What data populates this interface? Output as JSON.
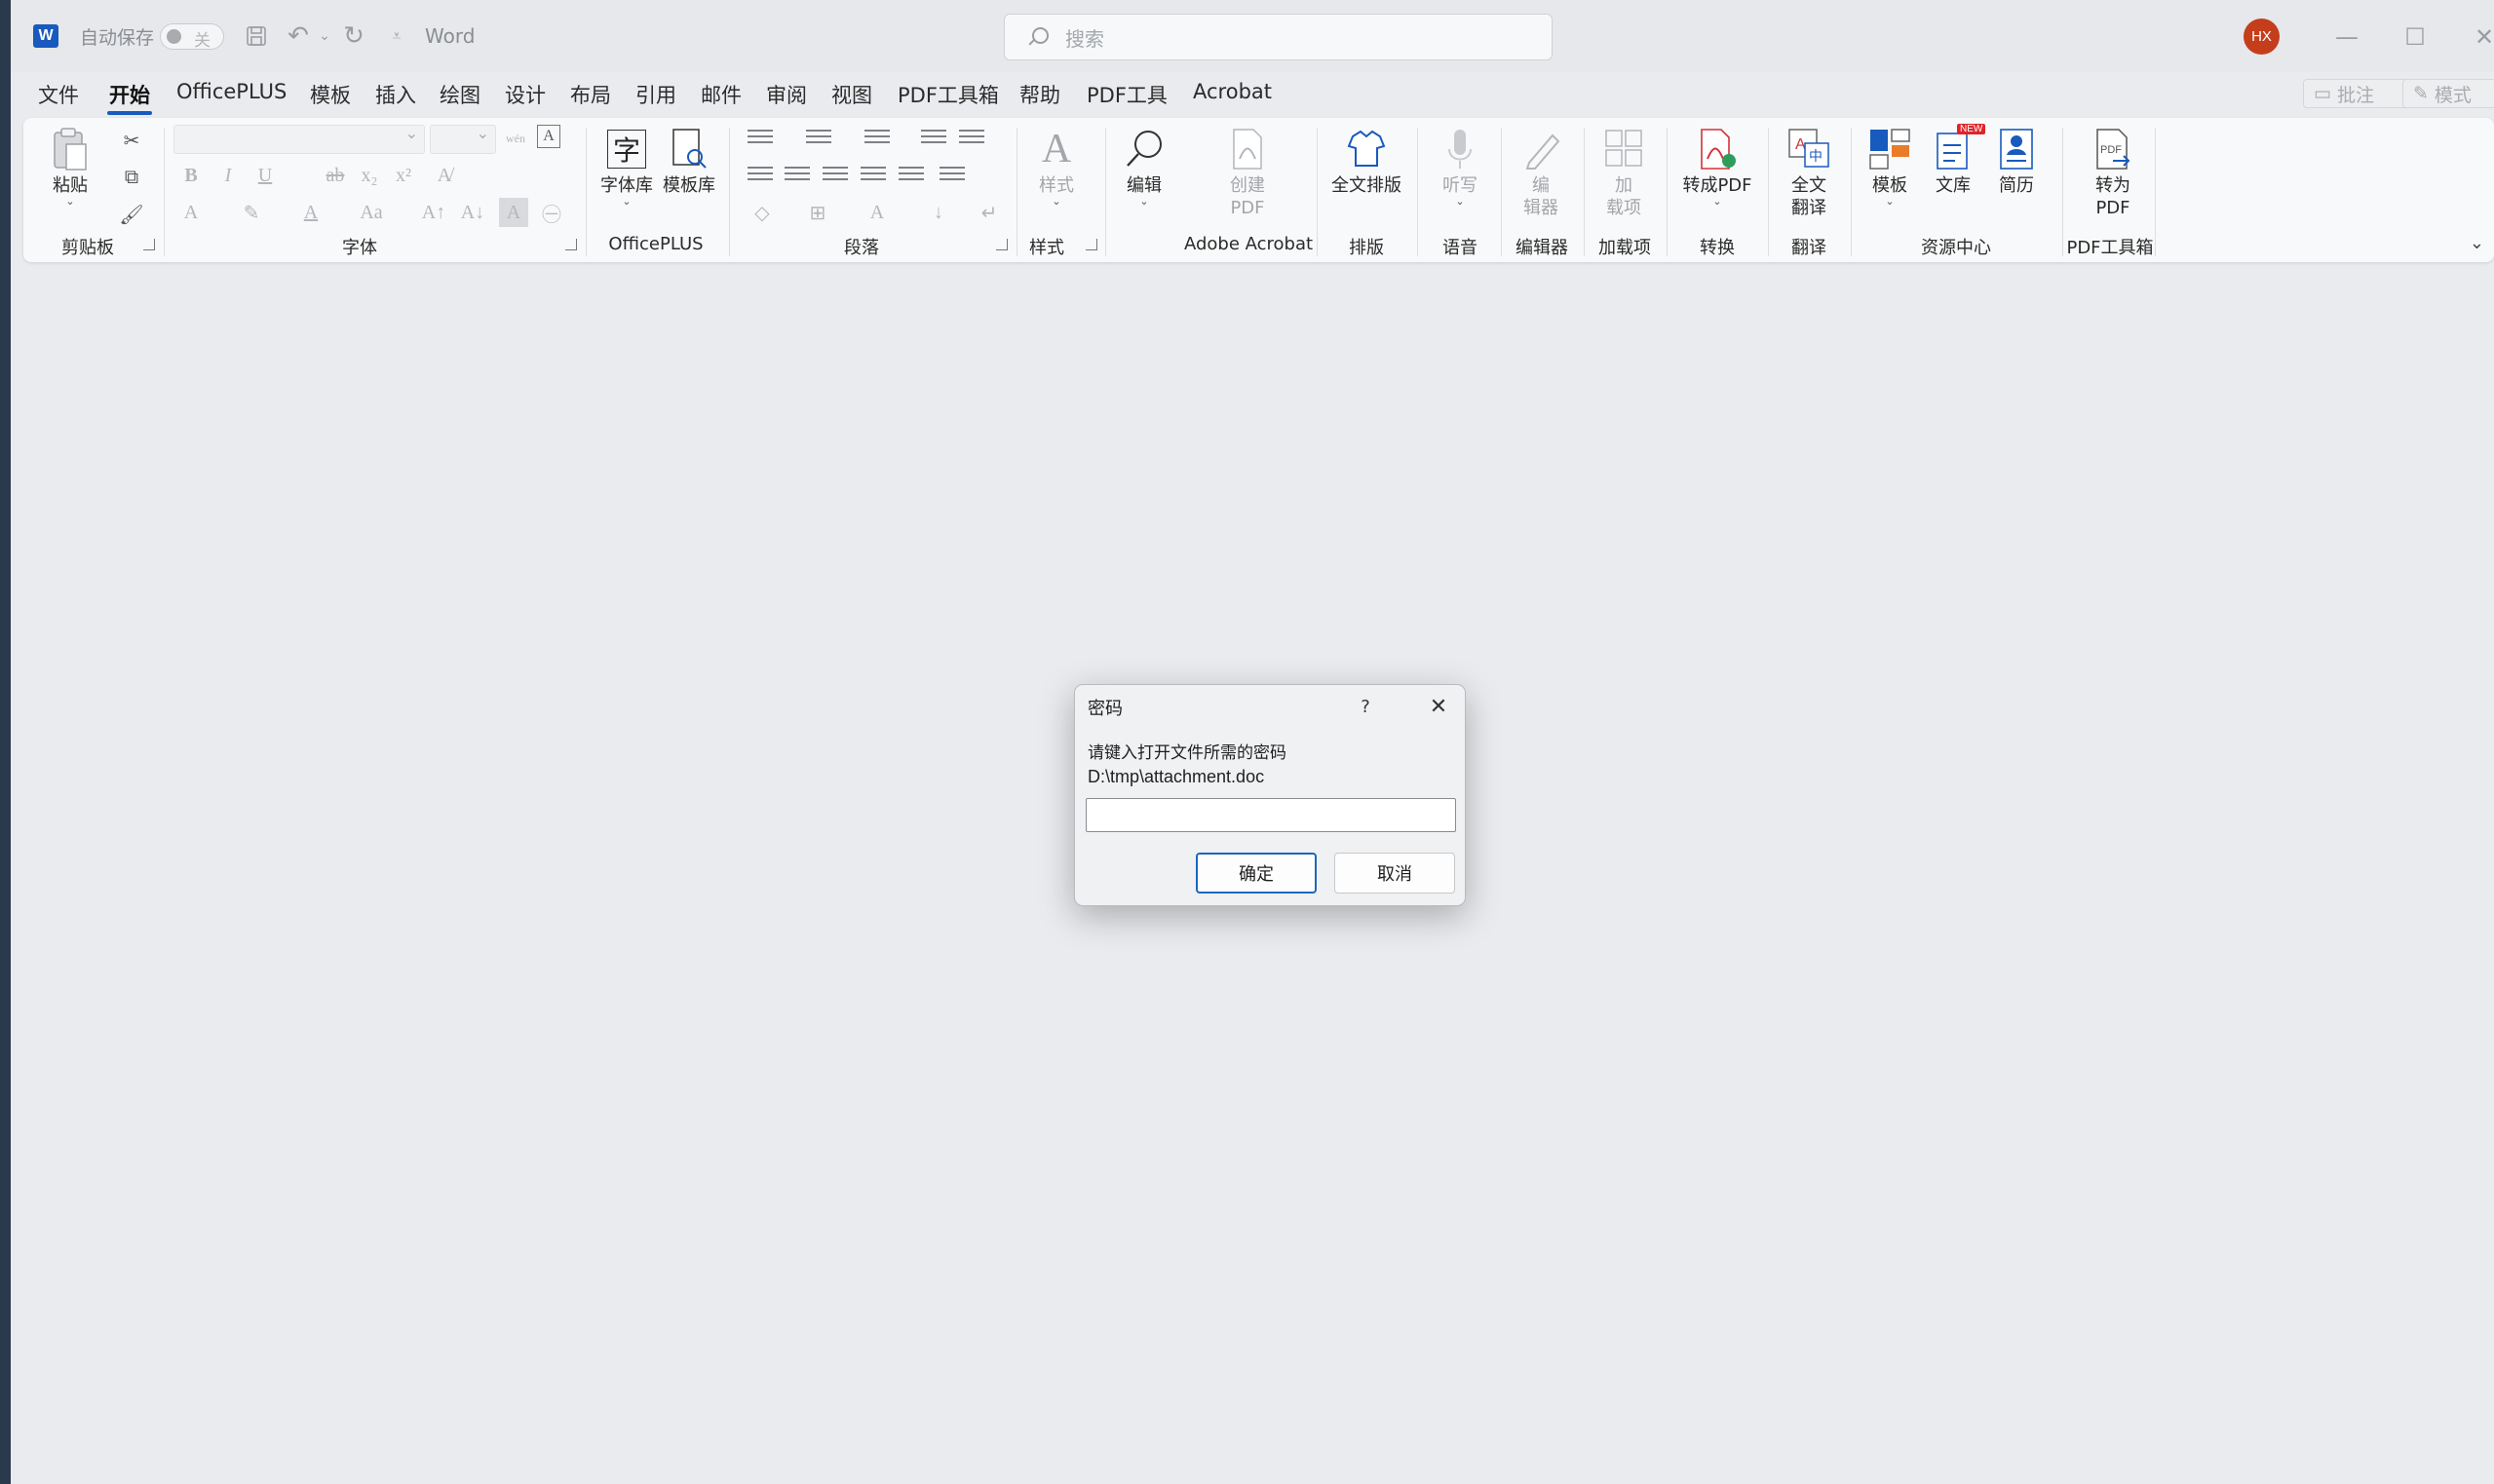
{
  "titlebar": {
    "autosave_label": "自动保存",
    "autosave_state": "关",
    "document_name": "Word",
    "search_placeholder": "搜索",
    "user_initials": "HX"
  },
  "menu": {
    "tabs": [
      "文件",
      "开始",
      "OfficePLUS",
      "模板",
      "插入",
      "绘图",
      "设计",
      "布局",
      "引用",
      "邮件",
      "审阅",
      "视图",
      "PDF工具箱",
      "帮助",
      "PDF工具",
      "Acrobat"
    ],
    "active_tab": "开始",
    "comments_label": "批注",
    "mode_label": "模式"
  },
  "ribbon": {
    "groups": {
      "clipboard": "剪贴板",
      "font": "字体",
      "officeplus": "OfficePLUS",
      "paragraph": "段落",
      "styles": "样式",
      "acrobat": "Adobe Acrobat",
      "layout": "排版",
      "voice": "语音",
      "editor": "编辑器",
      "addins": "加载项",
      "convert": "转换",
      "translate": "翻译",
      "resources": "资源中心",
      "pdftoolbox": "PDF工具箱"
    },
    "buttons": {
      "paste": "粘贴",
      "font_library": "字体库",
      "template_library": "模板库",
      "styles": "样式",
      "editing": "编辑",
      "create_pdf_1": "创建",
      "create_pdf_2": "PDF",
      "full_layout": "全文排版",
      "dictate": "听写",
      "editor_1": "编",
      "editor_2": "辑器",
      "addins_1": "加",
      "addins_2": "载项",
      "to_pdf": "转成PDF",
      "translate_1": "全文",
      "translate_2": "翻译",
      "templates": "模板",
      "library": "文库",
      "resume": "简历",
      "convert_pdf_1": "转为",
      "convert_pdf_2": "PDF",
      "new_badge": "NEW",
      "pinyin": "wén"
    }
  },
  "dialog": {
    "title": "密码",
    "help": "?",
    "prompt": "请键入打开文件所需的密码",
    "file_path": "D:\\tmp\\attachment.doc",
    "password_value": "",
    "ok_label": "确定",
    "cancel_label": "取消"
  },
  "colors": {
    "accent": "#185abd",
    "avatar": "#c43e1c",
    "default_button_border": "#1a67c0"
  }
}
